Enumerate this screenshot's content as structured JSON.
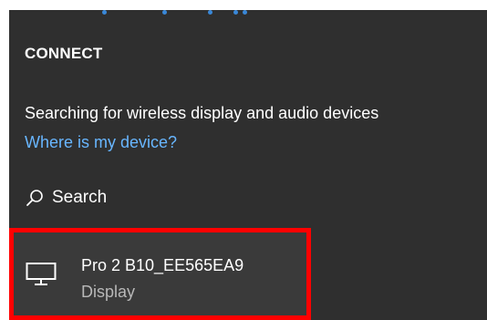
{
  "connect_panel": {
    "title": "CONNECT",
    "status_text": "Searching for wireless display and audio devices",
    "help_link": "Where is my device?",
    "search": {
      "label": "Search",
      "icon": "search-icon"
    },
    "devices": [
      {
        "name": "Pro 2 B10_EE565EA9",
        "type": "Display",
        "icon": "monitor-icon"
      }
    ],
    "progress_indicator": "scanning-dots"
  },
  "colors": {
    "panel_background": "#2f2f2f",
    "text": "#ffffff",
    "link": "#68b6ff",
    "secondary_text": "#b8b8b8",
    "highlight_border": "#ff0000",
    "progress_dots": "#3a88d8"
  }
}
